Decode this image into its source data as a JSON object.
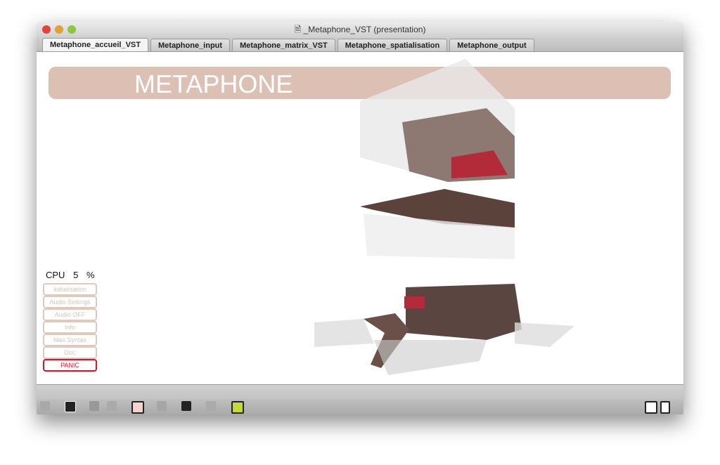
{
  "window": {
    "title": "_Metaphone_VST (presentation)"
  },
  "tabs": [
    {
      "label": "Metaphone_accueil_VST",
      "active": true
    },
    {
      "label": "Metaphone_input"
    },
    {
      "label": "Metaphone_matrix_VST"
    },
    {
      "label": "Metaphone_spatialisation"
    },
    {
      "label": "Metaphone_output"
    }
  ],
  "banner": {
    "title": "METAPHONE",
    "color": "#dcc0b4"
  },
  "cpu": {
    "label": "CPU",
    "value": "5",
    "unit": "%"
  },
  "buttons": [
    "Initialisation",
    "Audio Settings",
    "Audio OFF",
    "Info",
    "Max Syntax",
    "Doc"
  ],
  "panic": {
    "label": "PANIC",
    "color": "#e5102a"
  },
  "toolbar_icons": [
    "lock-icon",
    "presentation-toggle-icon",
    "clue-icon",
    "delete-icon",
    "patcher-icon",
    "inspector-icon",
    "add-object-icon",
    "grid-icon",
    "debug-icon"
  ],
  "toolbar_right_icons": [
    "split-view-icon",
    "single-view-icon"
  ]
}
